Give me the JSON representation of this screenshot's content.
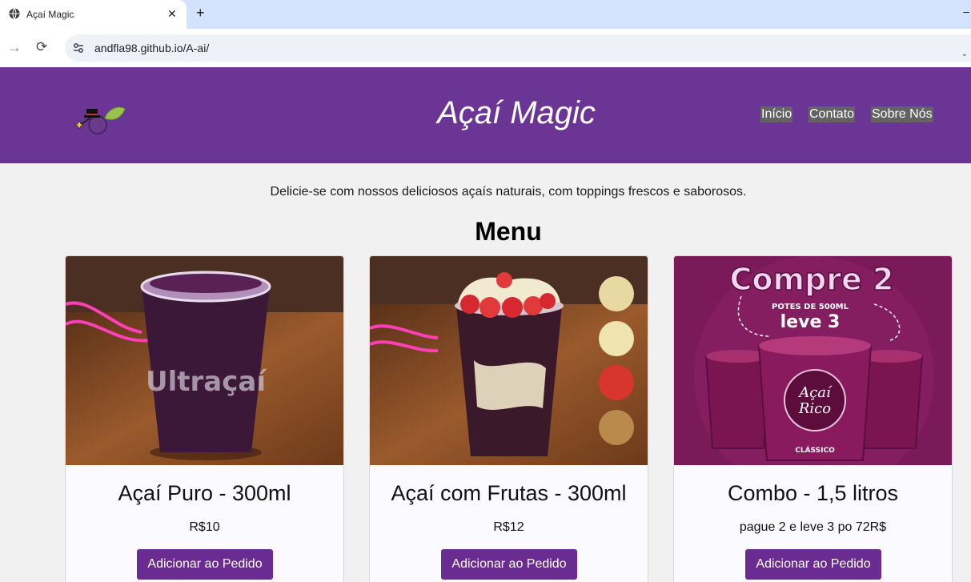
{
  "browser": {
    "tab_title": "Açaí Magic",
    "tab_close": "✕",
    "new_tab": "+",
    "minimize": "–",
    "forward": "→",
    "reload": "⟳",
    "url": "andfla98.github.io/A-ai/",
    "chevron": "⌄"
  },
  "header": {
    "title": "Açaí Magic",
    "nav": [
      "Início",
      "Contato",
      "Sobre Nós"
    ]
  },
  "intro": "Delicie-se com nossos deliciosos açaís naturais, com toppings frescos e saborosos.",
  "menu": {
    "heading": "Menu",
    "products": [
      {
        "name": "Açaí Puro - 300ml",
        "price": "R$10",
        "button": "Adicionar ao Pedido",
        "image_text": "Ultraçaí"
      },
      {
        "name": "Açaí com Frutas - 300ml",
        "price": "R$12",
        "button": "Adicionar ao Pedido"
      },
      {
        "name": "Combo - 1,5 litros",
        "price": "pague 2 e leve 3 po 72R$",
        "button": "Adicionar ao Pedido",
        "image_text": {
          "headline": "Compre 2",
          "sub1": "POTES DE 500ML",
          "sub2": "leve 3",
          "brand1": "Açaí",
          "brand2": "Rico",
          "flavor": "CLÁSSICO"
        }
      }
    ]
  },
  "colors": {
    "header_bg": "#6b3596",
    "button_bg": "#6b2c91",
    "page_bg": "#f1f1f1",
    "tab_strip": "#d3e3fd"
  }
}
